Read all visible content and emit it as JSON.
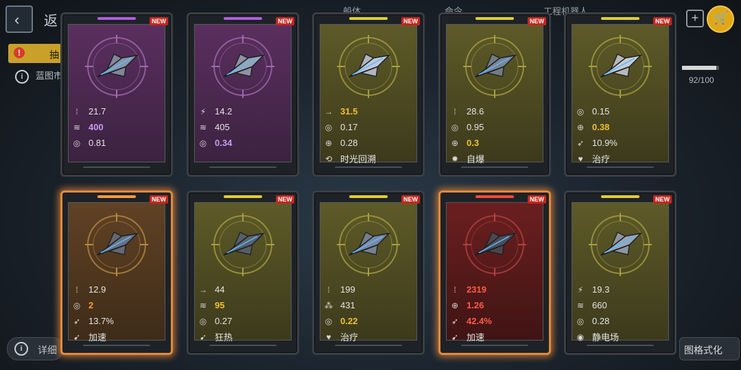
{
  "background": {
    "back_glyph": "‹",
    "title": "返",
    "tabs": [
      {
        "label": "船体"
      },
      {
        "label": "命令"
      },
      {
        "label": "工程机器人"
      }
    ],
    "orange_tab_label": "抽",
    "warn_glyph": "!",
    "info_glyph": "i",
    "info_text": "蓝图市",
    "progress_fraction": 0.92,
    "count_text": "92/100",
    "plus_glyph": "+",
    "cart_icon": "cart-icon",
    "detail_label": "详细",
    "format_label": "图格式化"
  },
  "cards": [
    {
      "rarity": "purple",
      "glow": false,
      "badge": "NEW",
      "ship_color": "#8a96a8",
      "stats": [
        {
          "icon": "ammo-icon",
          "glyph": "⁞",
          "value": "21.7",
          "color": "#e6e6e6"
        },
        {
          "icon": "wave-icon",
          "glyph": "≋",
          "value": "400",
          "color": "#c99bf2"
        },
        {
          "icon": "target-icon",
          "glyph": "◎",
          "value": "0.81",
          "color": "#e6e6e6"
        }
      ]
    },
    {
      "rarity": "purple",
      "glow": false,
      "badge": "NEW",
      "ship_color": "#9aa4b2",
      "stats": [
        {
          "icon": "missile-icon",
          "glyph": "⚡",
          "value": "14.2",
          "color": "#e6e6e6"
        },
        {
          "icon": "wave-icon",
          "glyph": "≋",
          "value": "405",
          "color": "#e6e6e6"
        },
        {
          "icon": "target-icon",
          "glyph": "◎",
          "value": "0.34",
          "color": "#c99bf2"
        }
      ]
    },
    {
      "rarity": "yellow",
      "glow": false,
      "badge": "NEW",
      "ship_color": "#c0c8d8",
      "stats": [
        {
          "icon": "arrow-icon",
          "glyph": "→",
          "value": "31.5",
          "color": "#f0c030"
        },
        {
          "icon": "target-icon",
          "glyph": "◎",
          "value": "0.17",
          "color": "#e6e6e6"
        },
        {
          "icon": "crosshair-icon",
          "glyph": "⊕",
          "value": "0.28",
          "color": "#e6e6e6"
        },
        {
          "icon": "time-icon",
          "glyph": "⟲",
          "value": "时光回溯",
          "color": "#e6e6e6"
        }
      ]
    },
    {
      "rarity": "yellow",
      "glow": false,
      "badge": "NEW",
      "ship_color": "#7a8494",
      "stats": [
        {
          "icon": "ammo-icon",
          "glyph": "⁞",
          "value": "28.6",
          "color": "#e6e6e6"
        },
        {
          "icon": "target-icon",
          "glyph": "◎",
          "value": "0.95",
          "color": "#e6e6e6"
        },
        {
          "icon": "crosshair-icon",
          "glyph": "⊕",
          "value": "0.3",
          "color": "#f0c030"
        },
        {
          "icon": "explode-icon",
          "glyph": "✸",
          "value": "自爆",
          "color": "#e6e6e6"
        }
      ]
    },
    {
      "rarity": "yellow",
      "glow": false,
      "badge": "NEW",
      "ship_color": "#c8ccd4",
      "stats": [
        {
          "icon": "target-icon",
          "glyph": "◎",
          "value": "0.15",
          "color": "#e6e6e6"
        },
        {
          "icon": "crosshair-icon",
          "glyph": "⊕",
          "value": "0.38",
          "color": "#f0c030"
        },
        {
          "icon": "rocket-icon",
          "glyph": "➶",
          "value": "10.9%",
          "color": "#e6e6e6"
        },
        {
          "icon": "heal-icon",
          "glyph": "♥",
          "value": "治疗",
          "color": "#e6e6e6"
        }
      ]
    },
    {
      "rarity": "orange",
      "glow": true,
      "badge": "NEW",
      "ship_color": "#6a7280",
      "stats": [
        {
          "icon": "ammo-icon",
          "glyph": "⁞",
          "value": "12.9",
          "color": "#e6e6e6"
        },
        {
          "icon": "target-icon",
          "glyph": "◎",
          "value": "2",
          "color": "#f0a030"
        },
        {
          "icon": "rocket-icon",
          "glyph": "➶",
          "value": "13.7%",
          "color": "#e6e6e6"
        },
        {
          "icon": "boost-icon",
          "glyph": "➹",
          "value": "加速",
          "color": "#e6e6e6"
        }
      ]
    },
    {
      "rarity": "yellow",
      "glow": false,
      "badge": "NEW",
      "ship_color": "#5a6270",
      "stats": [
        {
          "icon": "arrow-icon",
          "glyph": "→",
          "value": "44",
          "color": "#e6e6e6"
        },
        {
          "icon": "wave-icon",
          "glyph": "≋",
          "value": "95",
          "color": "#f0c030"
        },
        {
          "icon": "target-icon",
          "glyph": "◎",
          "value": "0.27",
          "color": "#e6e6e6"
        },
        {
          "icon": "frenzy-icon",
          "glyph": "➹",
          "value": "狂热",
          "color": "#e6e6e6"
        }
      ]
    },
    {
      "rarity": "yellow",
      "glow": false,
      "badge": "NEW",
      "ship_color": "#7a8aa0",
      "stats": [
        {
          "icon": "ammo-icon",
          "glyph": "⁞",
          "value": "199",
          "color": "#e6e6e6"
        },
        {
          "icon": "cluster-icon",
          "glyph": "⁂",
          "value": "431",
          "color": "#e6e6e6"
        },
        {
          "icon": "target-icon",
          "glyph": "◎",
          "value": "0.22",
          "color": "#f0c030"
        },
        {
          "icon": "heal-icon",
          "glyph": "♥",
          "value": "治疗",
          "color": "#e6e6e6"
        }
      ]
    },
    {
      "rarity": "red",
      "glow": true,
      "badge": "NEW",
      "ship_color": "#4a4e58",
      "stats": [
        {
          "icon": "ammo-icon",
          "glyph": "⁞",
          "value": "2319",
          "color": "#ff5a4a"
        },
        {
          "icon": "crosshair-icon",
          "glyph": "⊕",
          "value": "1.26",
          "color": "#ff5a4a"
        },
        {
          "icon": "rocket-icon",
          "glyph": "➶",
          "value": "42.4%",
          "color": "#ff5a4a"
        },
        {
          "icon": "boost-icon",
          "glyph": "➹",
          "value": "加速",
          "color": "#e6e6e6"
        }
      ]
    },
    {
      "rarity": "yellow",
      "glow": false,
      "badge": "NEW",
      "ship_color": "#9aa4b4",
      "stats": [
        {
          "icon": "missile-icon",
          "glyph": "⚡",
          "value": "19.3",
          "color": "#e6e6e6"
        },
        {
          "icon": "wave-icon",
          "glyph": "≋",
          "value": "660",
          "color": "#e6e6e6"
        },
        {
          "icon": "target-icon",
          "glyph": "◎",
          "value": "0.28",
          "color": "#e6e6e6"
        },
        {
          "icon": "static-icon",
          "glyph": "◉",
          "value": "静电场",
          "color": "#e6e6e6"
        }
      ]
    }
  ]
}
